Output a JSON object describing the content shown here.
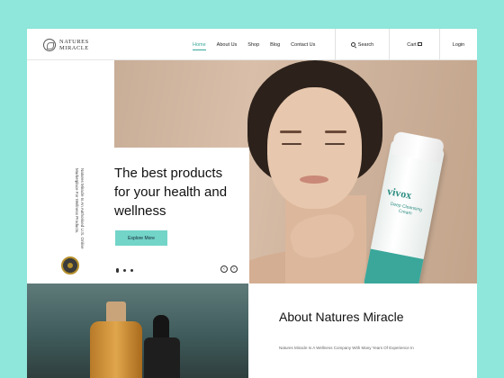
{
  "brand": {
    "line1": "NATURES",
    "line2": "MIRACLE"
  },
  "nav": {
    "items": [
      "Home",
      "About Us",
      "Shop",
      "Blog",
      "Contact Us"
    ],
    "active_index": 0
  },
  "header": {
    "search_label": "Search",
    "cart_label": "Cart",
    "login_label": "Login"
  },
  "hero": {
    "title": "The best products for your health and wellness",
    "cta_label": "Explore More",
    "side_text": "Natures Miracle Is An Authorised U.S. Online Marketplace For Wellness Products.",
    "product_brand": "vivox",
    "product_sub": "Deep Cleansing Cream"
  },
  "about": {
    "title": "About Natures Miracle",
    "text": "Natures Miracle Is A Wellness Company With Many Years Of Experience In"
  },
  "colors": {
    "page_bg": "#8fe6da",
    "accent": "#73d4c8",
    "nav_active": "#3aa79a"
  }
}
